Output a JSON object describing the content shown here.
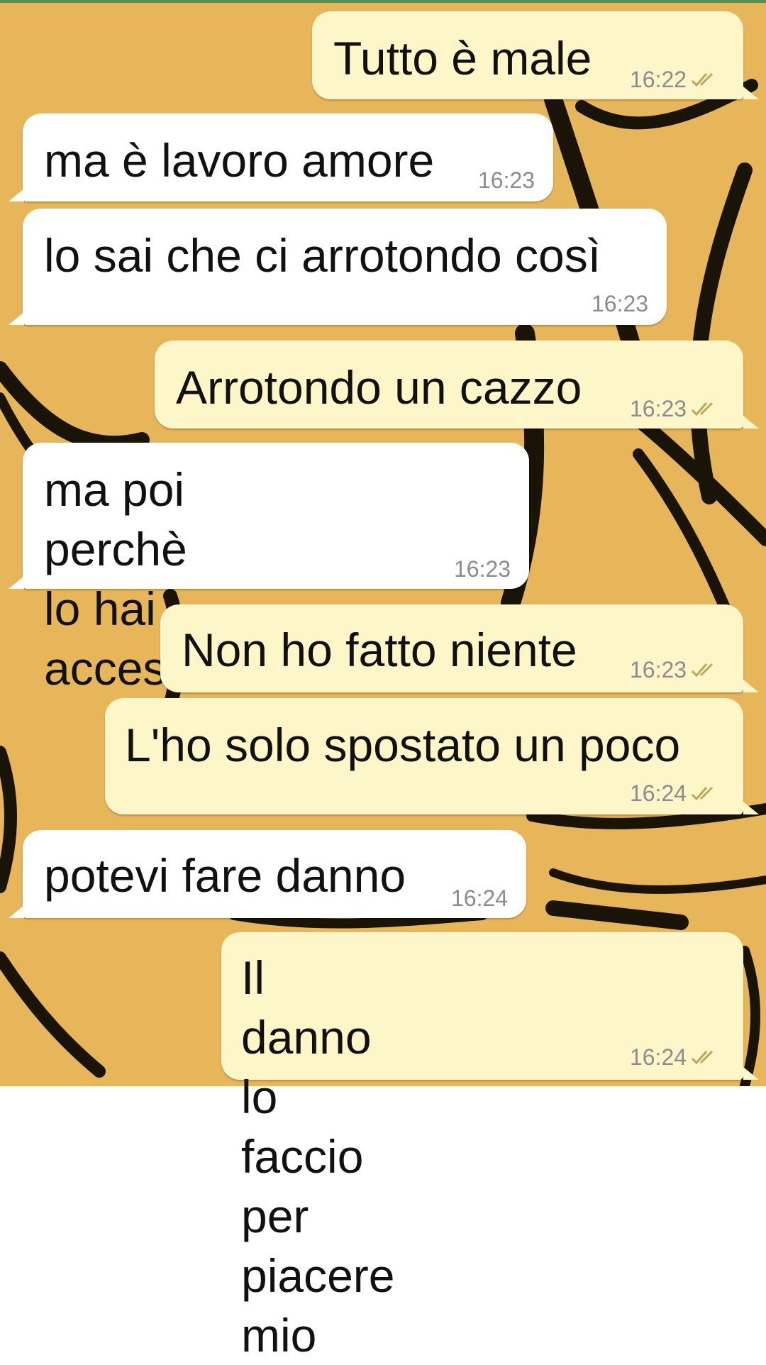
{
  "theme": {
    "wallpaper": "#e8b65a",
    "incoming_bubble": "#ffffff",
    "outgoing_bubble": "#fdf6c8",
    "timestamp_color": "#8c8c8c",
    "read_ticks_color": "#c0a75a"
  },
  "messages": [
    {
      "direction": "outgoing",
      "text": "Tutto è male",
      "time": "16:22",
      "status_icon": "double-check-icon"
    },
    {
      "direction": "incoming",
      "text": "ma è lavoro amore",
      "time": "16:23"
    },
    {
      "direction": "incoming",
      "text": "lo sai che ci arrotondo così",
      "time": "16:23"
    },
    {
      "direction": "outgoing",
      "text": "Arrotondo un cazzo",
      "time": "16:23",
      "status_icon": "double-check-icon"
    },
    {
      "direction": "incoming",
      "text": "ma poi perchè lo hai\nacceso?",
      "time": "16:23"
    },
    {
      "direction": "outgoing",
      "text": "Non ho fatto niente",
      "time": "16:23",
      "status_icon": "double-check-icon"
    },
    {
      "direction": "outgoing",
      "text": "L'ho solo spostato un poco",
      "time": "16:24",
      "status_icon": "double-check-icon"
    },
    {
      "direction": "incoming",
      "text": "potevi fare danno",
      "time": "16:24"
    },
    {
      "direction": "outgoing",
      "text": "Il danno lo faccio per\npiacere mio",
      "time": "16:24",
      "status_icon": "double-check-icon"
    }
  ]
}
